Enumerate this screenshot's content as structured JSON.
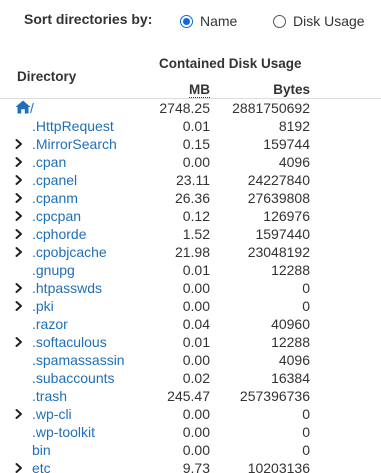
{
  "sort": {
    "label": "Sort directories by:",
    "options": [
      {
        "label": "Name",
        "selected": true
      },
      {
        "label": "Disk Usage",
        "selected": false
      }
    ]
  },
  "table": {
    "header_directory": "Directory",
    "header_contained": "Contained Disk Usage",
    "header_mb": "MB",
    "header_bytes": "Bytes",
    "rows": [
      {
        "name": "/",
        "mb": "2748.25",
        "bytes": "2881750692",
        "expandable": false,
        "home": true
      },
      {
        "name": ".HttpRequest",
        "mb": "0.01",
        "bytes": "8192",
        "expandable": false
      },
      {
        "name": ".MirrorSearch",
        "mb": "0.15",
        "bytes": "159744",
        "expandable": true
      },
      {
        "name": ".cpan",
        "mb": "0.00",
        "bytes": "4096",
        "expandable": true
      },
      {
        "name": ".cpanel",
        "mb": "23.11",
        "bytes": "24227840",
        "expandable": true
      },
      {
        "name": ".cpanm",
        "mb": "26.36",
        "bytes": "27639808",
        "expandable": true
      },
      {
        "name": ".cpcpan",
        "mb": "0.12",
        "bytes": "126976",
        "expandable": true
      },
      {
        "name": ".cphorde",
        "mb": "1.52",
        "bytes": "1597440",
        "expandable": true
      },
      {
        "name": ".cpobjcache",
        "mb": "21.98",
        "bytes": "23048192",
        "expandable": true
      },
      {
        "name": ".gnupg",
        "mb": "0.01",
        "bytes": "12288",
        "expandable": false
      },
      {
        "name": ".htpasswds",
        "mb": "0.00",
        "bytes": "0",
        "expandable": true
      },
      {
        "name": ".pki",
        "mb": "0.00",
        "bytes": "0",
        "expandable": true
      },
      {
        "name": ".razor",
        "mb": "0.04",
        "bytes": "40960",
        "expandable": false
      },
      {
        "name": ".softaculous",
        "mb": "0.01",
        "bytes": "12288",
        "expandable": true
      },
      {
        "name": ".spamassassin",
        "mb": "0.00",
        "bytes": "4096",
        "expandable": false
      },
      {
        "name": ".subaccounts",
        "mb": "0.02",
        "bytes": "16384",
        "expandable": false
      },
      {
        "name": ".trash",
        "mb": "245.47",
        "bytes": "257396736",
        "expandable": false
      },
      {
        "name": ".wp-cli",
        "mb": "0.00",
        "bytes": "0",
        "expandable": true
      },
      {
        "name": ".wp-toolkit",
        "mb": "0.00",
        "bytes": "0",
        "expandable": false
      },
      {
        "name": "bin",
        "mb": "0.00",
        "bytes": "0",
        "expandable": false
      },
      {
        "name": "etc",
        "mb": "9.73",
        "bytes": "10203136",
        "expandable": true
      }
    ]
  },
  "colors": {
    "link": "#1f6fb8",
    "radio_accent": "#0a6bd6",
    "text": "#333333"
  },
  "icons": {
    "root": "home-icon",
    "expander": "chevron-right-icon"
  }
}
